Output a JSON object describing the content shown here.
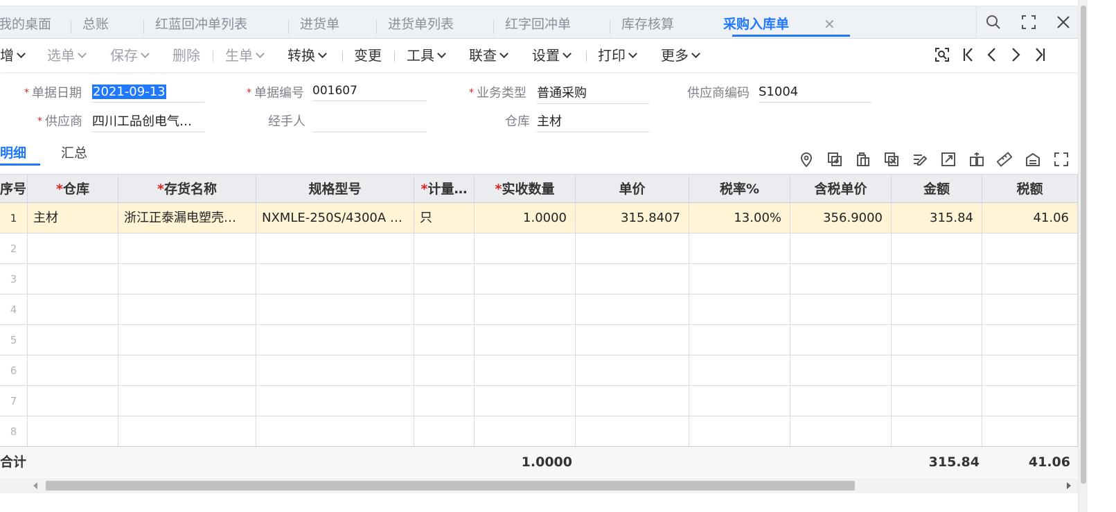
{
  "tabs": [
    {
      "label": "我的桌面"
    },
    {
      "label": "总账"
    },
    {
      "label": "红蓝回冲单列表"
    },
    {
      "label": "进货单"
    },
    {
      "label": "进货单列表"
    },
    {
      "label": "红字回冲单"
    },
    {
      "label": "库存核算"
    },
    {
      "label": "采购入库单",
      "active": true
    }
  ],
  "toolbar": {
    "items": [
      {
        "label": "增",
        "caret": true
      },
      {
        "label": "选单",
        "caret": true,
        "disabled": true
      },
      {
        "label": "保存",
        "caret": true,
        "disabled": true
      },
      {
        "label": "删除",
        "disabled": true
      },
      {
        "label": "生单",
        "caret": true,
        "disabled": true
      },
      {
        "label": "转换",
        "caret": true
      },
      {
        "label": "变更"
      },
      {
        "label": "工具",
        "caret": true
      },
      {
        "label": "联查",
        "caret": true
      },
      {
        "label": "设置",
        "caret": true
      },
      {
        "label": "打印",
        "caret": true
      },
      {
        "label": "更多",
        "caret": true
      }
    ]
  },
  "form": {
    "doc_date_label": "单据日期",
    "doc_date_value": "2021-09-13",
    "doc_no_label": "单据编号",
    "doc_no_value": "001607",
    "biz_type_label": "业务类型",
    "biz_type_value": "普通采购",
    "supplier_code_label": "供应商编码",
    "supplier_code_value": "S1004",
    "supplier_label": "供应商",
    "supplier_value": "四川工品创电气…",
    "handler_label": "经手人",
    "handler_value": "",
    "warehouse_label": "仓库",
    "warehouse_value": "主材"
  },
  "detail_tabs": [
    {
      "label": "明细",
      "active": true
    },
    {
      "label": "汇总"
    }
  ],
  "grid": {
    "columns": [
      "序号",
      "仓库",
      "存货名称",
      "规格型号",
      "计量…",
      "实收数量",
      "单价",
      "税率%",
      "含税单价",
      "金额",
      "税额"
    ],
    "required": [
      false,
      true,
      true,
      false,
      true,
      true,
      false,
      false,
      false,
      false,
      false
    ],
    "rows": [
      [
        "1",
        "主材",
        "浙江正泰漏电塑壳…",
        "NXMLE-250S/4300A …",
        "只",
        "1.0000",
        "315.8407",
        "13.00%",
        "356.9000",
        "315.84",
        "41.06"
      ],
      [
        "2",
        "",
        "",
        "",
        "",
        "",
        "",
        "",
        "",
        "",
        ""
      ],
      [
        "3",
        "",
        "",
        "",
        "",
        "",
        "",
        "",
        "",
        "",
        ""
      ],
      [
        "4",
        "",
        "",
        "",
        "",
        "",
        "",
        "",
        "",
        "",
        ""
      ],
      [
        "5",
        "",
        "",
        "",
        "",
        "",
        "",
        "",
        "",
        "",
        ""
      ],
      [
        "6",
        "",
        "",
        "",
        "",
        "",
        "",
        "",
        "",
        "",
        ""
      ],
      [
        "7",
        "",
        "",
        "",
        "",
        "",
        "",
        "",
        "",
        "",
        ""
      ],
      [
        "8",
        "",
        "",
        "",
        "",
        "",
        "",
        "",
        "",
        "",
        ""
      ]
    ],
    "footer": {
      "label": "合计",
      "qty": "1.0000",
      "amount": "315.84",
      "tax": "41.06"
    }
  },
  "icons": {
    "search": "search-icon",
    "fullscreen": "fullscreen-icon",
    "close": "close-icon",
    "accent": "#1f78ff",
    "row_highlight": "#fff5d6"
  }
}
